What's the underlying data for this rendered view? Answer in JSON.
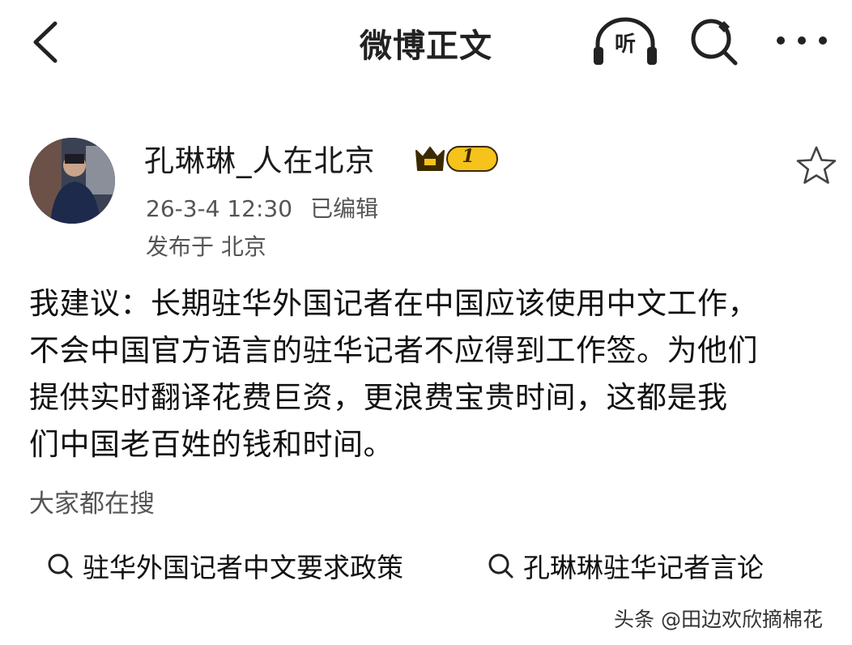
{
  "header": {
    "title": "微博正文",
    "back_icon": "chevron-left-icon",
    "listen_label": "听",
    "listen_icon": "headphones-icon",
    "search_icon": "search-icon",
    "more_icon": "more-dots-icon"
  },
  "post": {
    "author": "孔琳琳_人在北京",
    "vip_level": "1",
    "vip_colors": {
      "gold": "#f5c31c",
      "dark": "#3b2a00"
    },
    "timestamp": "26-3-4 12:30",
    "edited_label": "已编辑",
    "location": "发布于 北京",
    "favorite_icon": "star-outline-icon",
    "body_lines": [
      "我建议：长期驻华外国记者在中国应该使用中文工作，",
      "不会中国官方语言的驻华记者不应得到工作签。为他们",
      "提供实时翻译花费巨资，更浪费宝贵时间，这都是我",
      "们中国老百姓的钱和时间。"
    ]
  },
  "trending": {
    "title": "大家都在搜",
    "items": [
      {
        "icon": "search-icon",
        "label": "驻华外国记者中文要求政策"
      },
      {
        "icon": "search-icon",
        "label": "孔琳琳驻华记者言论"
      }
    ]
  },
  "watermark": "头条 @田边欢欣摘棉花"
}
